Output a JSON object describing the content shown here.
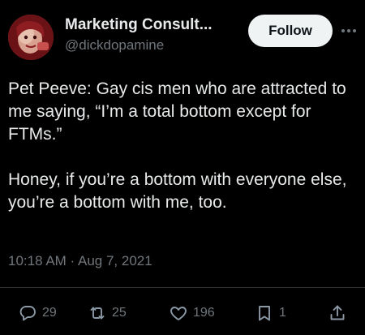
{
  "author": {
    "display_name": "Marketing Consult...",
    "handle": "@dickdopamine"
  },
  "follow_label": "Follow",
  "tweet": {
    "paragraphs": [
      "Pet Peeve: Gay cis men who are attracted to me saying, “I’m a total bottom except for FTMs.”",
      "Honey, if you’re a bottom with everyone else, you’re a bottom with me, too."
    ],
    "timestamp": "10:18 AM · Aug 7, 2021"
  },
  "actions": {
    "replies": "29",
    "retweets": "25",
    "likes": "196",
    "bookmarks": "1"
  },
  "colors": {
    "background": "#000000",
    "text": "#e7e9ea",
    "muted": "#71767b",
    "follow_bg": "#eff3f4"
  },
  "icons": [
    "reply-icon",
    "retweet-icon",
    "like-icon",
    "bookmark-icon",
    "share-icon",
    "more-icon"
  ]
}
